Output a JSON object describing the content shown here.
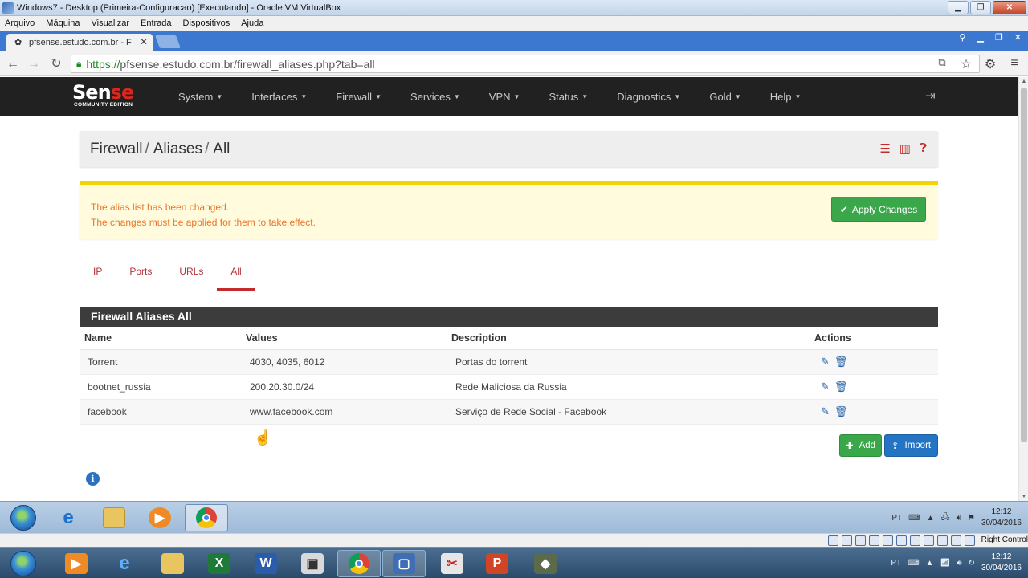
{
  "vbox": {
    "title": "Windows7 - Desktop (Primeira-Configuracao) [Executando] - Oracle VM VirtualBox",
    "menu": [
      "Arquivo",
      "Máquina",
      "Visualizar",
      "Entrada",
      "Dispositivos",
      "Ajuda"
    ],
    "status_right": "Right Control"
  },
  "browser": {
    "tab_title": "pfsense.estudo.com.br - F",
    "url_proto": "https://",
    "url_rest": "pfsense.estudo.com.br/firewall_aliases.php?tab=all"
  },
  "navbar": {
    "logo_main_a": "Sen",
    "logo_main_b": "se",
    "logo_sub": "COMMUNITY EDITION",
    "items": [
      "System",
      "Interfaces",
      "Firewall",
      "Services",
      "VPN",
      "Status",
      "Diagnostics",
      "Gold",
      "Help"
    ]
  },
  "breadcrumb": {
    "part1": "Firewall",
    "part2": "Aliases",
    "part3": "All",
    "sep": "/"
  },
  "alert": {
    "line1": "The alias list has been changed.",
    "line2": "The changes must be applied for them to take effect.",
    "apply_label": "Apply Changes"
  },
  "tabs": [
    "IP",
    "Ports",
    "URLs",
    "All"
  ],
  "panel": {
    "title": "Firewall Aliases All",
    "columns": [
      "Name",
      "Values",
      "Description",
      "Actions"
    ],
    "rows": [
      {
        "name": "Torrent",
        "values": "4030, 4035, 6012",
        "description": "Portas do torrent"
      },
      {
        "name": "bootnet_russia",
        "values": "200.20.30.0/24",
        "description": "Rede Maliciosa da Russia"
      },
      {
        "name": "facebook",
        "values": "www.facebook.com",
        "description": "Serviço de Rede Social - Facebook"
      }
    ],
    "add_label": "Add",
    "import_label": "Import"
  },
  "guest_tray": {
    "lang": "PT",
    "time": "12:12",
    "date": "30/04/2016"
  },
  "host_tray": {
    "lang": "PT",
    "time": "12:12",
    "date": "30/04/2016"
  },
  "colors": {
    "accent_red": "#c12b2b",
    "navbar": "#212121",
    "success": "#3aa84a",
    "primary": "#2474c4",
    "alert_bg": "#fffbdc"
  }
}
